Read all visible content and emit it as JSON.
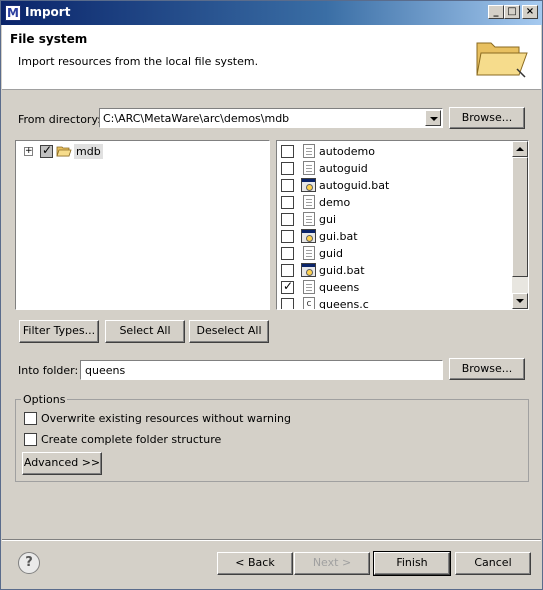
{
  "window": {
    "title": "Import",
    "app_icon": "M",
    "controls": {
      "minimize": "_",
      "maximize": "□",
      "close": "×"
    }
  },
  "header": {
    "title": "File system",
    "description": "Import resources from the local file system."
  },
  "from_directory": {
    "label": "From directory:",
    "value": "C:\\ARC\\MetaWare\\arc\\demos\\mdb",
    "browse": "Browse..."
  },
  "tree": {
    "items": [
      {
        "label": "mdb",
        "expander": "+"
      }
    ]
  },
  "files": {
    "items": [
      {
        "label": "autodemo",
        "icon": "file-icon",
        "checked": false
      },
      {
        "label": "autoguid",
        "icon": "file-icon",
        "checked": false
      },
      {
        "label": "autoguid.bat",
        "icon": "bat-icon",
        "checked": false
      },
      {
        "label": "demo",
        "icon": "file-icon",
        "checked": false
      },
      {
        "label": "gui",
        "icon": "file-icon",
        "checked": false
      },
      {
        "label": "gui.bat",
        "icon": "bat-icon",
        "checked": false
      },
      {
        "label": "guid",
        "icon": "file-icon",
        "checked": false
      },
      {
        "label": "guid.bat",
        "icon": "bat-icon",
        "checked": false
      },
      {
        "label": "queens",
        "icon": "file-icon",
        "checked": true
      },
      {
        "label": "queens.c",
        "icon": "c-icon",
        "checked": false
      }
    ]
  },
  "buttons": {
    "filter_types": "Filter Types...",
    "select_all": "Select All",
    "deselect_all": "Deselect All"
  },
  "into_folder": {
    "label": "Into folder:",
    "value": "queens",
    "browse": "Browse..."
  },
  "options": {
    "title": "Options",
    "overwrite": "Overwrite existing resources without warning",
    "create_structure": "Create complete folder structure",
    "advanced": "Advanced >>"
  },
  "footer": {
    "help": "?",
    "back": "< Back",
    "next": "Next >",
    "finish": "Finish",
    "cancel": "Cancel"
  }
}
